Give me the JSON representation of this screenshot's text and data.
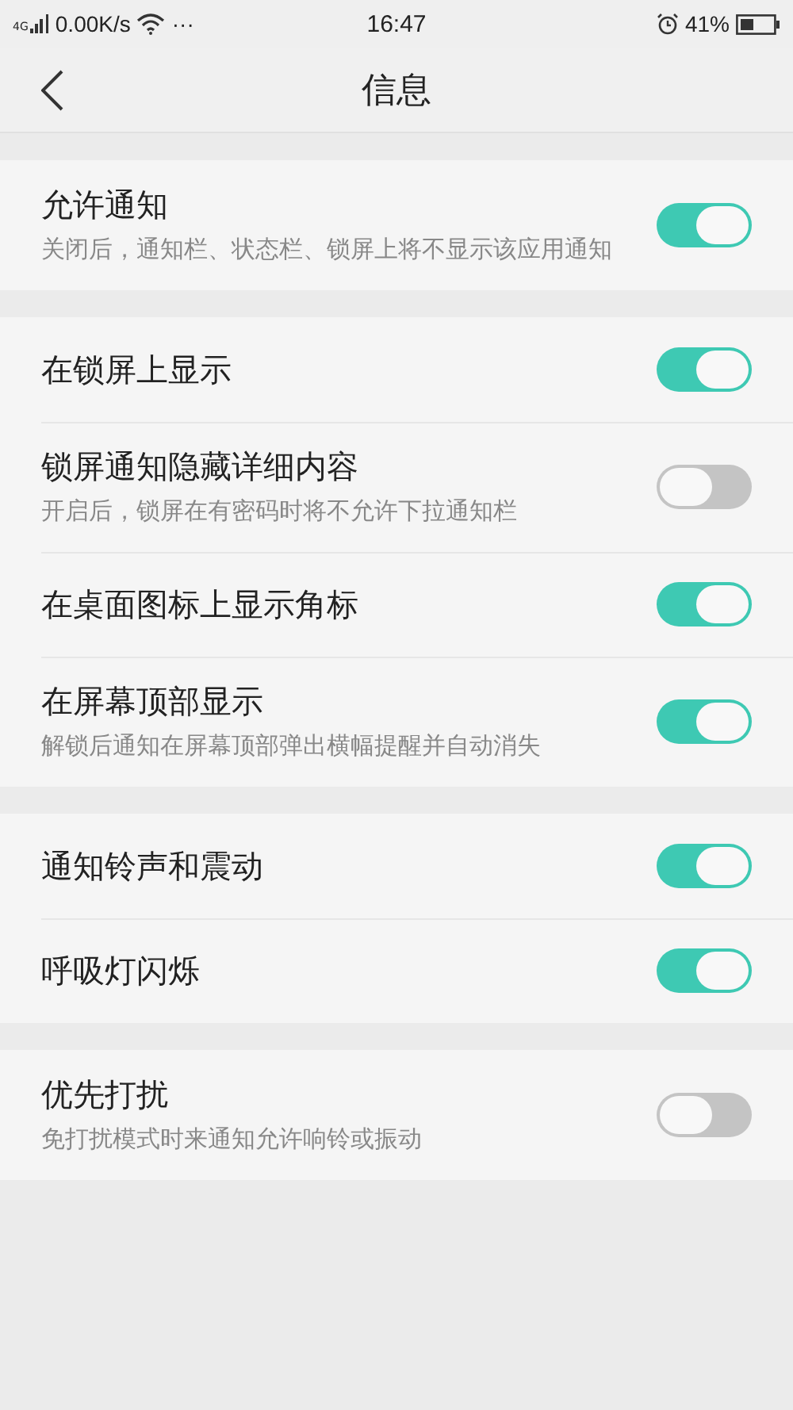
{
  "status_bar": {
    "network": "4G",
    "speed": "0.00K/s",
    "more": "···",
    "time": "16:47",
    "battery": "41%"
  },
  "header": {
    "title": "信息"
  },
  "groups": [
    {
      "rows": [
        {
          "title": "允许通知",
          "description": "关闭后，通知栏、状态栏、锁屏上将不显示该应用通知",
          "on": true
        }
      ]
    },
    {
      "rows": [
        {
          "title": "在锁屏上显示",
          "on": true
        },
        {
          "title": "锁屏通知隐藏详细内容",
          "description": "开启后，锁屏在有密码时将不允许下拉通知栏",
          "on": false
        },
        {
          "title": "在桌面图标上显示角标",
          "on": true
        },
        {
          "title": "在屏幕顶部显示",
          "description": "解锁后通知在屏幕顶部弹出横幅提醒并自动消失",
          "on": true
        }
      ]
    },
    {
      "rows": [
        {
          "title": "通知铃声和震动",
          "on": true
        },
        {
          "title": "呼吸灯闪烁",
          "on": true
        }
      ]
    },
    {
      "rows": [
        {
          "title": "优先打扰",
          "description": "免打扰模式时来通知允许响铃或振动",
          "on": false
        }
      ]
    }
  ]
}
